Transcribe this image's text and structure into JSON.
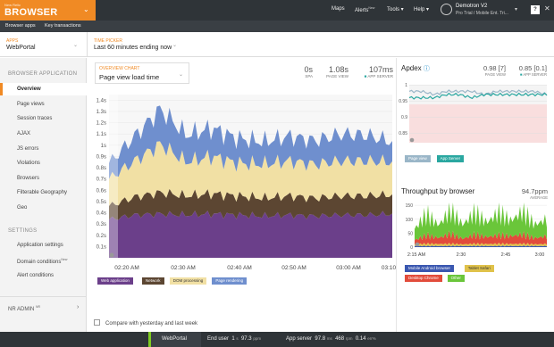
{
  "brand": {
    "small": "New Relic",
    "name": "BROWSER"
  },
  "topnav": {
    "maps": "Maps",
    "alerts": "Alerts",
    "alerts_badge": "New",
    "tools": "Tools",
    "help": "Help",
    "account_name": "Demotron V2",
    "account_sub": "Pro Trial / Mobile Ent. Tri..."
  },
  "subnav": {
    "browser_apps": "Browser apps",
    "key_transactions": "Key transactions"
  },
  "context": {
    "apps_label": "APPS",
    "apps_value": "WebPortal",
    "time_label": "TIME PICKER",
    "time_value": "Last 60 minutes ending now"
  },
  "sidebar": {
    "section1": "BROWSER APPLICATION",
    "items": [
      "Overview",
      "Page views",
      "Session traces",
      "AJAX",
      "JS errors",
      "Violations",
      "Browsers",
      "Filterable Geography",
      "Geo"
    ],
    "section2": "SETTINGS",
    "settings": [
      "Application settings",
      "Domain conditions",
      "Alert conditions"
    ],
    "settings_badge": "New",
    "nr_admin": "NR ADMIN",
    "nr_admin_badge": "NR"
  },
  "overview": {
    "chart_label": "OVERVIEW CHART",
    "chart_value": "Page view load time",
    "spa_value": "0s",
    "spa_label": "SPA",
    "pageview_value": "1.08s",
    "pageview_label": "PAGE VIEW",
    "appserver_value": "107ms",
    "appserver_label": "APP SERVER"
  },
  "chart_data": [
    {
      "type": "area",
      "title": "Page view load time",
      "x": [
        "02:15",
        "02:20",
        "02:25",
        "02:30",
        "02:35",
        "02:40",
        "02:45",
        "02:50",
        "02:55",
        "03:00",
        "03:05",
        "03:10"
      ],
      "xticks": [
        "02:20 AM",
        "02:30 AM",
        "02:40 AM",
        "02:50 AM",
        "03:00 AM",
        "03:10"
      ],
      "yticks": [
        "0.1s",
        "0.2s",
        "0.3s",
        "0.4s",
        "0.5s",
        "0.6s",
        "0.7s",
        "0.8s",
        "0.9s",
        "1s",
        "1.1s",
        "1.2s",
        "1.3s",
        "1.4s"
      ],
      "ylim": [
        0,
        1.45
      ],
      "series": [
        {
          "name": "Web application",
          "color": "#6b3f8a",
          "values": [
            0.34,
            0.38,
            0.39,
            0.38,
            0.39,
            0.38,
            0.37,
            0.38,
            0.37,
            0.38,
            0.38,
            0.39
          ]
        },
        {
          "name": "Network",
          "color": "#5c4632",
          "values": [
            0.12,
            0.16,
            0.19,
            0.17,
            0.18,
            0.17,
            0.16,
            0.17,
            0.16,
            0.17,
            0.17,
            0.17
          ]
        },
        {
          "name": "DOM processing",
          "color": "#f1e0a4",
          "values": [
            0.24,
            0.32,
            0.43,
            0.3,
            0.33,
            0.29,
            0.3,
            0.31,
            0.3,
            0.31,
            0.31,
            0.29
          ]
        },
        {
          "name": "Page rendering",
          "color": "#6f8fce",
          "values": [
            0.14,
            0.22,
            0.31,
            0.24,
            0.25,
            0.22,
            0.2,
            0.22,
            0.21,
            0.24,
            0.23,
            0.18
          ]
        }
      ]
    },
    {
      "type": "line",
      "title": "Apdex",
      "yticks": [
        "0.85",
        "0.9",
        "0.95",
        "1"
      ],
      "ylim": [
        0.82,
        1.02
      ],
      "series": [
        {
          "name": "Page view",
          "color": "#9ab6c8",
          "value_label": "0.98 [7]",
          "values": [
            0.98,
            0.98,
            0.97,
            0.98,
            0.98,
            0.98,
            0.97,
            0.98,
            0.98,
            0.98,
            0.98,
            0.97
          ]
        },
        {
          "name": "App Server",
          "color": "#2aa7a0",
          "value_label": "0.85 [0.1]",
          "values": [
            0.96,
            0.96,
            0.96,
            0.97,
            0.97,
            0.96,
            0.97,
            0.97,
            0.97,
            0.97,
            0.97,
            0.97
          ]
        }
      ]
    },
    {
      "type": "area",
      "title": "Throughput by browser",
      "x": [
        "2:15 AM",
        "2:30",
        "2:45",
        "3:00"
      ],
      "yticks": [
        "0",
        "50",
        "100",
        "150"
      ],
      "ylim": [
        0,
        160
      ],
      "average": "94.7ppm",
      "average_label": "AVERAGE",
      "series": [
        {
          "name": "Mobile Android browser",
          "color": "#3a57b0",
          "values": [
            4,
            4,
            4,
            4,
            4,
            4,
            4,
            4,
            4,
            4,
            4,
            4
          ]
        },
        {
          "name": "Tablet Safari",
          "color": "#e0c24a",
          "values": [
            6,
            8,
            7,
            8,
            6,
            8,
            7,
            8,
            7,
            8,
            6,
            7
          ]
        },
        {
          "name": "Desktop Chrome",
          "color": "#e24c3b",
          "values": [
            15,
            30,
            22,
            35,
            20,
            32,
            25,
            30,
            28,
            33,
            22,
            28
          ]
        },
        {
          "name": "Other",
          "color": "#6ac63a",
          "values": [
            40,
            75,
            45,
            85,
            50,
            78,
            52,
            80,
            55,
            82,
            48,
            60
          ]
        }
      ]
    }
  ],
  "apdex": {
    "title": "Apdex",
    "pv_value": "0.98 [7]",
    "pv_label": "PAGE VIEW",
    "as_value": "0.85 [0.1]",
    "as_label": "APP SERVER"
  },
  "throughput": {
    "title": "Throughput by browser",
    "value": "94.7ppm",
    "label": "AVERAGE"
  },
  "compare": "Compare with yesterday and last week",
  "footer": {
    "app": "WebPortal",
    "enduser_label": "End user",
    "enduser_val": "1",
    "enduser_unit": "s",
    "enduser_ms": "97.3",
    "enduser_ms_unit": "ppm",
    "appserver_label": "App server",
    "as_ms": "97.8",
    "as_ms_unit": "ms",
    "as_rpm": "468",
    "as_rpm_unit": "rpm",
    "as_err": "0.14",
    "as_err_unit": "err%"
  }
}
